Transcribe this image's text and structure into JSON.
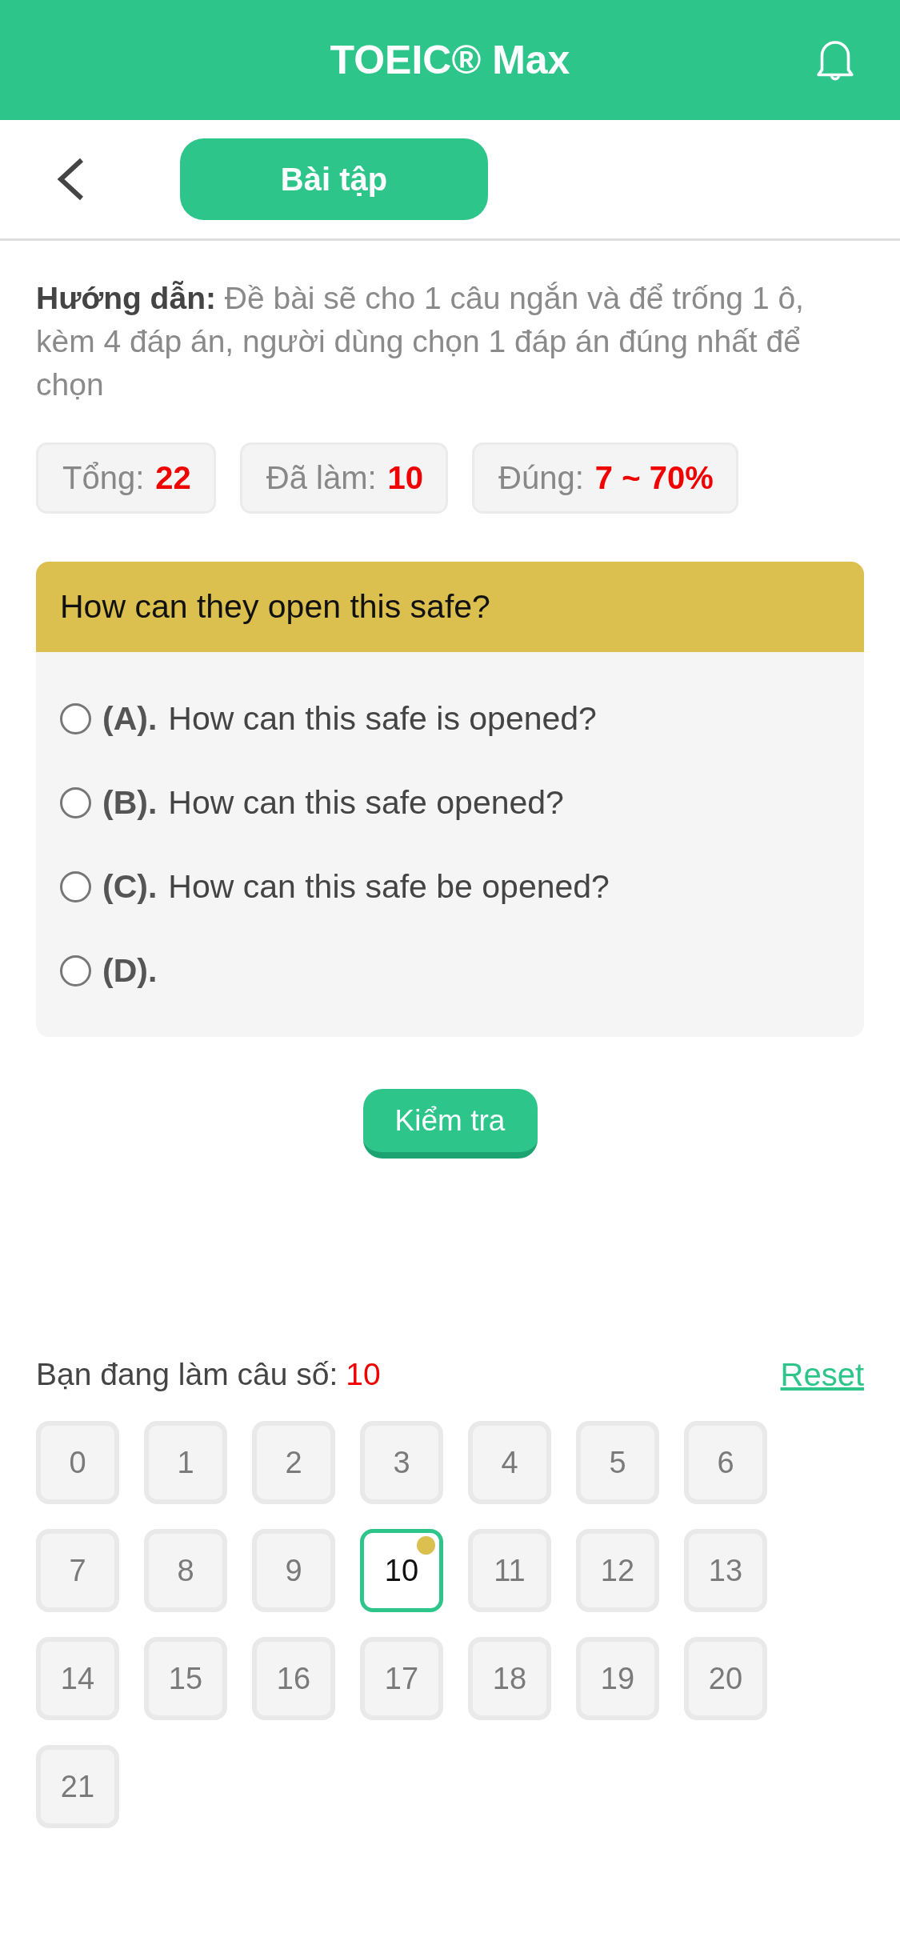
{
  "header": {
    "title": "TOEIC® Max"
  },
  "toolbar": {
    "tab_button": "Bài tập"
  },
  "instructions": "**Hướng dẫn:** Đề bài sẽ cho 1 câu ngắn và để trống 1 ô, kèm 4 đáp án, người dùng chọn 1 đáp án đúng nhất để chọn",
  "stats": [
    {
      "label": "Tổng:",
      "value": "22"
    },
    {
      "label": "Đã làm:",
      "value": "10"
    },
    {
      "label": "Đúng:",
      "value": "7 ~ 70%"
    }
  ],
  "question": {
    "prompt": "How can they open this safe?",
    "options": [
      {
        "letter": "(A).",
        "text": "How can this safe is opened?",
        "selected": false
      },
      {
        "letter": "(B).",
        "text": "How can this safe opened?",
        "selected": false
      },
      {
        "letter": "(C).",
        "text": "How can this safe be opened?",
        "selected": false
      },
      {
        "letter": "(D).",
        "selected": false
      }
    ]
  },
  "check_button": "Kiểm tra",
  "progress": {
    "label": "Bạn đang làm câu số:",
    "current": "10",
    "reset": "Reset"
  },
  "question_grid": [
    {
      "label": "0",
      "selected": false,
      "marked": false
    },
    {
      "label": "1",
      "selected": false,
      "marked": false
    },
    {
      "label": "2",
      "selected": false,
      "marked": false
    },
    {
      "label": "3",
      "selected": false,
      "marked": false
    },
    {
      "label": "4",
      "selected": false,
      "marked": false
    },
    {
      "label": "5",
      "selected": false,
      "marked": false
    },
    {
      "label": "6",
      "selected": false,
      "marked": false
    },
    {
      "label": "7",
      "selected": false,
      "marked": false
    },
    {
      "label": "8",
      "selected": false,
      "marked": false
    },
    {
      "label": "9",
      "selected": false,
      "marked": false
    },
    {
      "label": "10",
      "selected": true,
      "marked": true
    },
    {
      "label": "11",
      "selected": false,
      "marked": false
    },
    {
      "label": "12",
      "selected": false,
      "marked": false
    },
    {
      "label": "13",
      "selected": false,
      "marked": false
    },
    {
      "label": "14",
      "selected": false,
      "marked": false
    },
    {
      "label": "15",
      "selected": false,
      "marked": false
    },
    {
      "label": "16",
      "selected": false,
      "marked": false
    },
    {
      "label": "17",
      "selected": false,
      "marked": false
    },
    {
      "label": "18",
      "selected": false,
      "marked": false
    },
    {
      "label": "19",
      "selected": false,
      "marked": false
    },
    {
      "label": "20",
      "selected": false,
      "marked": false
    },
    {
      "label": "21",
      "selected": false,
      "marked": false
    }
  ]
}
